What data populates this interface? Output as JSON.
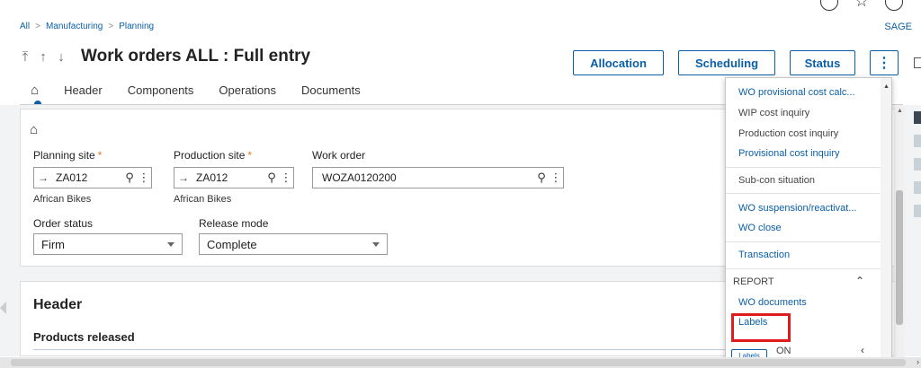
{
  "breadcrumb": [
    "All",
    "Manufacturing",
    "Planning"
  ],
  "brand": "SAGE",
  "title": "Work orders ALL : Full entry",
  "nav_arrows": [
    "⤒",
    "↑",
    "↓",
    "⤓"
  ],
  "actions": {
    "allocation": "Allocation",
    "scheduling": "Scheduling",
    "status": "Status",
    "more": "⋮"
  },
  "tabs": [
    "Header",
    "Components",
    "Operations",
    "Documents"
  ],
  "form": {
    "planning_site": {
      "label": "Planning site",
      "value": "ZA012",
      "desc": "African Bikes"
    },
    "production_site": {
      "label": "Production site",
      "value": "ZA012",
      "desc": "African Bikes"
    },
    "work_order": {
      "label": "Work order",
      "value": "WOZA0120200"
    },
    "order_status": {
      "label": "Order status",
      "value": "Firm"
    },
    "release_mode": {
      "label": "Release mode",
      "value": "Complete"
    }
  },
  "section": {
    "title": "Header",
    "subtitle": "Products released"
  },
  "menu": {
    "items_top": [
      {
        "label": "WO provisional cost calc...",
        "style": "link"
      },
      {
        "label": "WIP cost inquiry",
        "style": "plain"
      },
      {
        "label": "Production cost inquiry",
        "style": "plain"
      },
      {
        "label": "Provisional cost inquiry",
        "style": "link"
      },
      {
        "label": "Sub-con situation",
        "style": "plain"
      },
      {
        "label": "WO suspension/reactivat...",
        "style": "link"
      },
      {
        "label": "WO close",
        "style": "link"
      },
      {
        "label": "Transaction",
        "style": "link"
      }
    ],
    "report_header": "REPORT",
    "report_items": [
      "WO documents",
      "Labels"
    ],
    "next_section_partial": "ON",
    "mini_button": "Labels"
  },
  "colors": {
    "accent": "#0a5fa8",
    "required": "#e87722",
    "highlight": "#e01b1b"
  }
}
